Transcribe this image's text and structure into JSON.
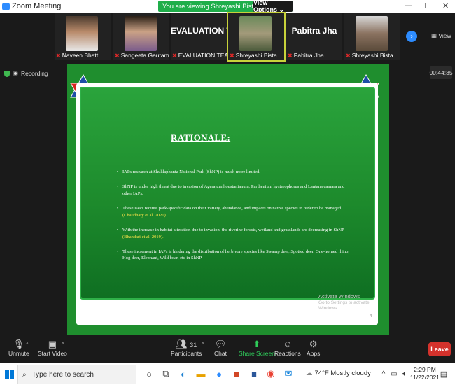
{
  "titlebar": {
    "app_name": "Zoom Meeting",
    "banner_text": "You are viewing Shreyashi Bista's screen",
    "view_options": "View Options ⌄",
    "minimize": "—",
    "maximize": "☐",
    "close": "✕"
  },
  "participants_strip": {
    "tiles": [
      {
        "name": "Naveen Bhatt",
        "type": "photo"
      },
      {
        "name": "Sangeeta Gautam",
        "type": "photo"
      },
      {
        "name": "EVALUATION TEAM",
        "big_text": "EVALUATION  T...",
        "type": "text"
      },
      {
        "name": "Shreyashi Bista",
        "type": "photo",
        "active": true
      },
      {
        "name": "Pabitra Jha",
        "big_text": "Pabitra Jha",
        "type": "text"
      },
      {
        "name": "Shreyashi Bista",
        "type": "photo"
      }
    ],
    "next_label": "›",
    "view_label": "View"
  },
  "status": {
    "recording_label": "Recording",
    "timer": "00:44:35"
  },
  "slide": {
    "title": "RATIONALE:",
    "bullets": [
      {
        "text": "IAPs research at Shuklaphanta National Park (ShNP) is much more limited.",
        "cite": ""
      },
      {
        "text": "ShNP is under high threat due to invasion of Ageratum houstanianum, Parthenium hysterophorus and Lantana camara and other IAPs.",
        "cite": ""
      },
      {
        "text": "These IAPs require park-specific data on their variety, abundance, and impacts on native species in order to be managed",
        "cite": "(Chaudhary et al. 2020)."
      },
      {
        "text": "With the increase in habitat alteration due to invasion, the riverine forests, wetland and grasslands are decreasing in ShNP",
        "cite": "(Bhandari et al. 2019)."
      },
      {
        "text": "These increment in IAPs is hindering the distribution of herbivore species like Swamp deer, Spotted deer, One-horned rhino, Hog deer, Elephant, Wild boar, etc in ShNP.",
        "cite": ""
      }
    ],
    "activate_title": "Activate Windows",
    "activate_sub": "Go to Settings to activate Windows.",
    "page_number": "4"
  },
  "controls": {
    "unmute": "Unmute",
    "start_video": "Start Video",
    "participants": "Participants",
    "participants_count": "31",
    "chat": "Chat",
    "share_screen": "Share Screen",
    "reactions": "Reactions",
    "apps": "Apps",
    "leave": "Leave"
  },
  "taskbar": {
    "search_placeholder": "Type here to search",
    "weather": "74°F  Mostly cloudy",
    "time": "2:29 PM",
    "date": "11/22/2021"
  }
}
